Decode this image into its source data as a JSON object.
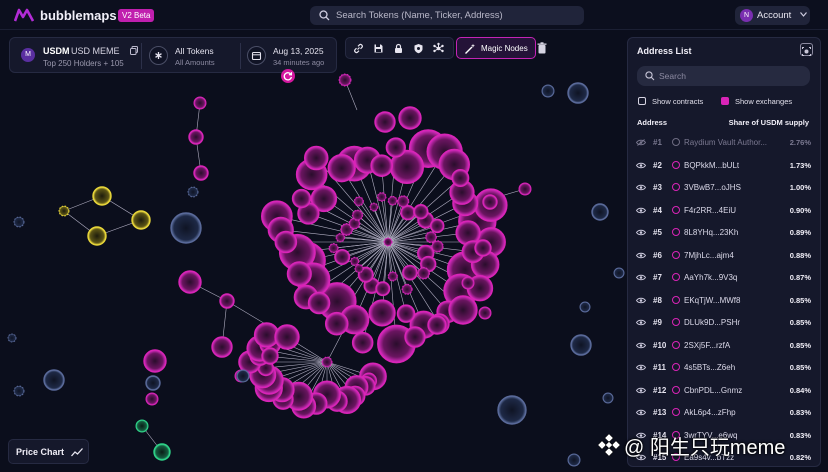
{
  "app": {
    "name": "bubblemaps",
    "badge": "V2 Beta"
  },
  "search": {
    "placeholder": "Search Tokens (Name, Ticker, Address)"
  },
  "account": {
    "avatar_letter": "N",
    "label": "Account"
  },
  "token_panel": {
    "badge_letter": "M",
    "symbol": "USDM",
    "name": "USD MEME",
    "holders": "Top 250 Holders + 105",
    "filter_title": "All Tokens",
    "filter_sub": "All Amounts",
    "date": "Aug 13, 2025",
    "ago": "34 minutes ago"
  },
  "toolbar": {
    "icons": [
      "link-icon",
      "save-icon",
      "lock-icon",
      "shield-icon",
      "network-icon"
    ],
    "magic_label": "Magic Nodes"
  },
  "address_panel": {
    "title": "Address List",
    "search_placeholder": "Search",
    "show_contracts": "Show contracts",
    "show_exchanges": "Show exchanges",
    "col_address": "Address",
    "col_share": "Share of USDM supply",
    "rows": [
      {
        "rank": "#1",
        "address": "Raydium Vault Author...",
        "share": "2.76%",
        "dim": true
      },
      {
        "rank": "#2",
        "address": "BQPkkM...bULt",
        "share": "1.73%"
      },
      {
        "rank": "#3",
        "address": "3VBwB7...oJHS",
        "share": "1.00%"
      },
      {
        "rank": "#4",
        "address": "F4r2RR...4EiU",
        "share": "0.90%"
      },
      {
        "rank": "#5",
        "address": "8L8YHq...23Kh",
        "share": "0.89%"
      },
      {
        "rank": "#6",
        "address": "7MjhLc...ajm4",
        "share": "0.88%"
      },
      {
        "rank": "#7",
        "address": "AaYh7k...9V3q",
        "share": "0.87%"
      },
      {
        "rank": "#8",
        "address": "EKqTjW...MWf8",
        "share": "0.85%"
      },
      {
        "rank": "#9",
        "address": "DLUk9D...PSHr",
        "share": "0.85%"
      },
      {
        "rank": "#10",
        "address": "2SXj5F...rzfA",
        "share": "0.85%"
      },
      {
        "rank": "#11",
        "address": "4s5BTs...Z6eh",
        "share": "0.85%"
      },
      {
        "rank": "#12",
        "address": "CbnPDL...Gnmz",
        "share": "0.84%"
      },
      {
        "rank": "#13",
        "address": "AkL6p4...zFhp",
        "share": "0.83%"
      },
      {
        "rank": "#14",
        "address": "3wrTYV...e6wq",
        "share": "0.83%"
      },
      {
        "rank": "#15",
        "address": "Ea9s4v...bTzz",
        "share": "0.82%"
      }
    ]
  },
  "price_chart": {
    "label": "Price Chart"
  },
  "watermark": {
    "text": "@ 阳生只玩meme"
  },
  "colors": {
    "background": "#0b0e1c",
    "accent": "#d924b7",
    "cluster_yellow": "#e8d63a",
    "cluster_green": "#2fd388",
    "node_gray": "#5a6a9a"
  }
}
